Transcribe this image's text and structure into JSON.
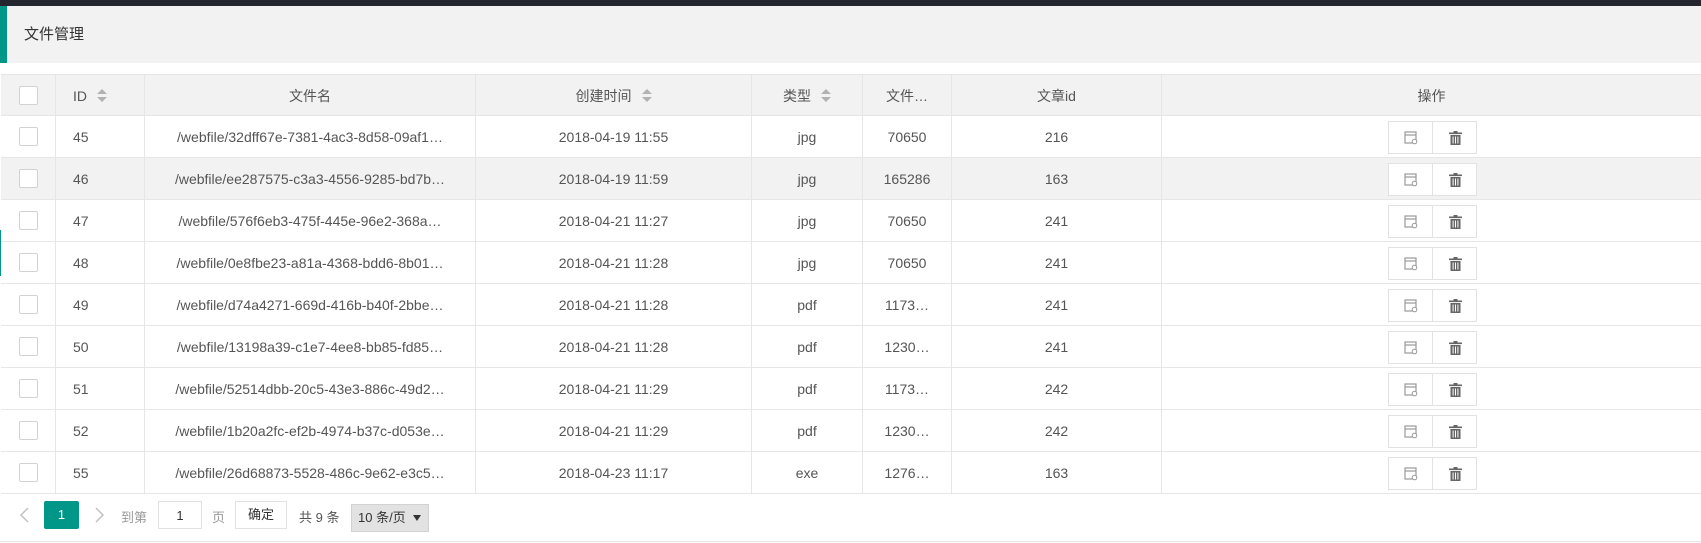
{
  "title": "文件管理",
  "table": {
    "headers": {
      "id": "ID",
      "filename": "文件名",
      "created": "创建时间",
      "type": "类型",
      "size": "文件…",
      "article_id": "文章id",
      "actions": "操作"
    },
    "rows": [
      {
        "id": "45",
        "filename": "/webfile/32dff67e-7381-4ac3-8d58-09af1…",
        "created": "2018-04-19 11:55",
        "type": "jpg",
        "size": "70650",
        "article_id": "216"
      },
      {
        "id": "46",
        "filename": "/webfile/ee287575-c3a3-4556-9285-bd7b…",
        "created": "2018-04-19 11:59",
        "type": "jpg",
        "size": "165286",
        "article_id": "163"
      },
      {
        "id": "47",
        "filename": "/webfile/576f6eb3-475f-445e-96e2-368a…",
        "created": "2018-04-21 11:27",
        "type": "jpg",
        "size": "70650",
        "article_id": "241"
      },
      {
        "id": "48",
        "filename": "/webfile/0e8fbe23-a81a-4368-bdd6-8b01…",
        "created": "2018-04-21 11:28",
        "type": "jpg",
        "size": "70650",
        "article_id": "241"
      },
      {
        "id": "49",
        "filename": "/webfile/d74a4271-669d-416b-b40f-2bbe…",
        "created": "2018-04-21 11:28",
        "type": "pdf",
        "size": "1173…",
        "article_id": "241"
      },
      {
        "id": "50",
        "filename": "/webfile/13198a39-c1e7-4ee8-bb85-fd85…",
        "created": "2018-04-21 11:28",
        "type": "pdf",
        "size": "1230…",
        "article_id": "241"
      },
      {
        "id": "51",
        "filename": "/webfile/52514dbb-20c5-43e3-886c-49d2…",
        "created": "2018-04-21 11:29",
        "type": "pdf",
        "size": "1173…",
        "article_id": "242"
      },
      {
        "id": "52",
        "filename": "/webfile/1b20a2fc-ef2b-4974-b37c-d053e…",
        "created": "2018-04-21 11:29",
        "type": "pdf",
        "size": "1230…",
        "article_id": "242"
      },
      {
        "id": "55",
        "filename": "/webfile/26d68873-5528-486c-9e62-e3c5…",
        "created": "2018-04-23 11:17",
        "type": "exe",
        "size": "1276…",
        "article_id": "163"
      }
    ],
    "row_actions": {
      "view_icon": "file-view-icon",
      "delete_icon": "trash-icon"
    }
  },
  "pagination": {
    "current_page": "1",
    "goto_label": "到第",
    "goto_value": "1",
    "page_unit": "页",
    "confirm_label": "确定",
    "total_text": "共 9 条",
    "page_size": "10 条/页"
  },
  "colors": {
    "accent": "#009688",
    "header_bg": "#f2f2f2",
    "topbar": "#23262e"
  }
}
